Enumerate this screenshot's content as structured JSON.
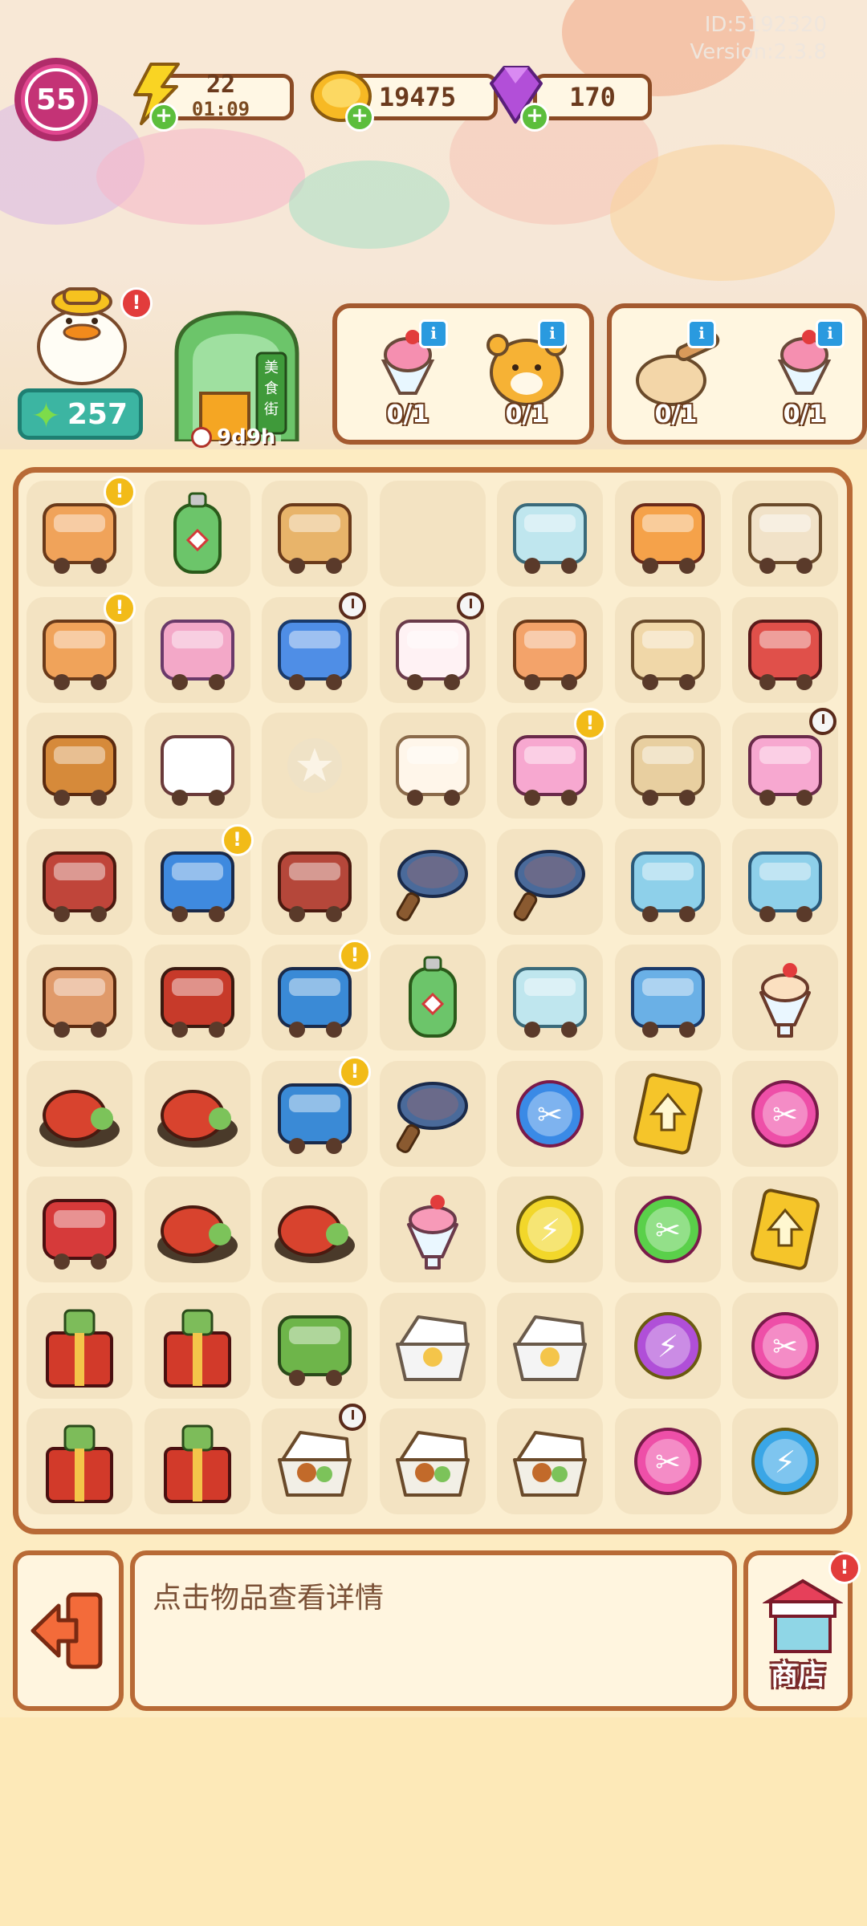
{
  "header": {
    "player_id": "ID:5192320",
    "version": "Version:2.3.8",
    "level": "55",
    "energy": {
      "value": "22",
      "timer": "01:09"
    },
    "coins": "19475",
    "gems": "170"
  },
  "character": {
    "stars": "257",
    "gate_timer": "9d9h"
  },
  "orders": [
    {
      "items": [
        {
          "icon": "sundae-icon",
          "count": "0/1"
        },
        {
          "icon": "tiger-icon",
          "count": "0/1"
        }
      ]
    },
    {
      "items": [
        {
          "icon": "dough-icon",
          "count": "0/1"
        },
        {
          "icon": "sundae-icon",
          "count": "0/1"
        }
      ]
    }
  ],
  "board": {
    "rows": [
      [
        "stall-bench-icon",
        "gas-tank-icon",
        "pancakes-icon",
        "",
        "bowls-icon",
        "umbrella-cart-icon",
        "box-icon"
      ],
      [
        "stall-bench-icon",
        "balloons-icon",
        "truck-icon",
        "ice-cream-van-icon",
        "bunting-icon",
        "boxes-icon",
        "keychain-icon"
      ],
      [
        "bread-basket-icon",
        "chef-hat-icon",
        "star-icon",
        "bun-icon",
        "pink-cart-icon",
        "luggage-cart-icon",
        "pink-cart-icon"
      ],
      [
        "grill-table-icon",
        "lobster-stall-icon",
        "picnic-table-icon",
        "frying-pan-icon",
        "frying-pan-icon",
        "poster-icon",
        "poster-icon"
      ],
      [
        "skewers-icon",
        "bbq-grill-icon",
        "bbq-cart-icon",
        "gas-tank-icon",
        "bowls-icon",
        "gift-box-icon",
        "cocktail-icon"
      ],
      [
        "lobster-plate-icon",
        "lobster-plate-icon",
        "bbq-cart-icon",
        "frying-pan-icon",
        "scissors-bubble-icon",
        "upgrade-card-icon",
        "scissors-bubble-icon"
      ],
      [
        "fridge-icon",
        "lobster-plate-icon",
        "lobster-plate-icon",
        "sundae-icon",
        "energy-bubble-icon",
        "scissors-bubble-icon",
        "upgrade-card-icon"
      ],
      [
        "gift-chest-icon",
        "gift-chest-icon",
        "backpack-icon",
        "takeout-box-icon",
        "takeout-box-icon",
        "energy-bubble-icon",
        "scissors-bubble-icon"
      ],
      [
        "gift-chest-icon",
        "gift-chest-icon",
        "bento-box-icon",
        "bento-box-icon",
        "bento-box-icon",
        "scissors-bubble-icon",
        "energy-bubble-icon"
      ]
    ]
  },
  "info_panel": {
    "text": "点击物品查看详情"
  },
  "shop": {
    "label": "商店"
  },
  "gate_sign": "美食街",
  "colors": {
    "board_border": "#b86a36",
    "cell_bg": "#f3e3c2",
    "accent_pink": "#e0468f",
    "accent_teal": "#3cb5a2"
  }
}
